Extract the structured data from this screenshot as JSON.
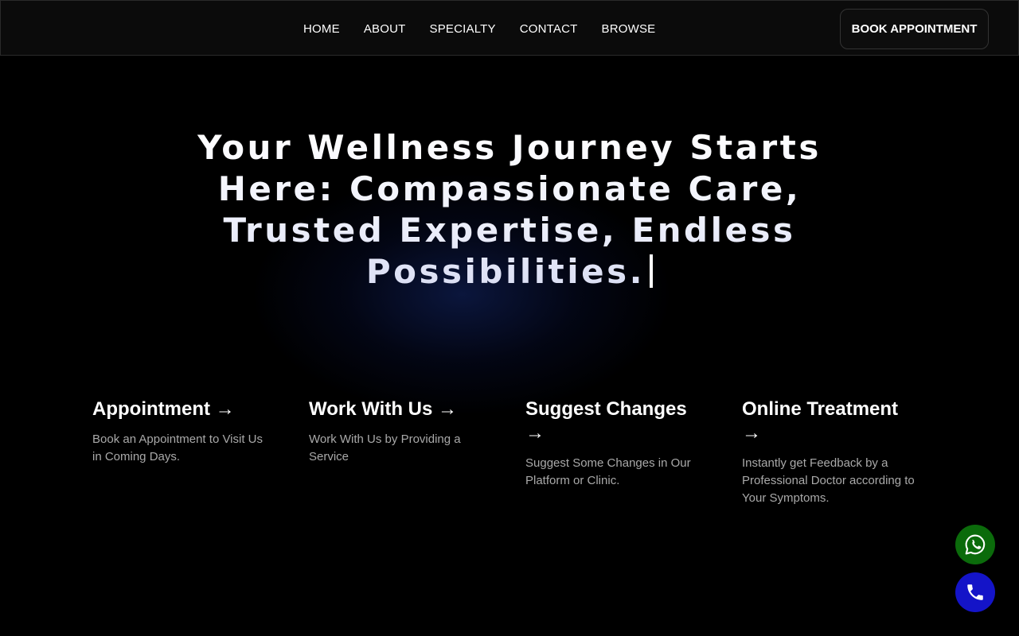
{
  "nav": {
    "links": [
      "HOME",
      "ABOUT",
      "SPECIALTY",
      "CONTACT",
      "BROWSE"
    ],
    "cta": "BOOK APPOINTMENT"
  },
  "hero": {
    "title": "Your Wellness Journey Starts Here: Compassionate Care, Trusted Expertise, Endless Possibilities."
  },
  "cards": [
    {
      "title": "Appointment →",
      "desc": "Book an Appointment to Visit Us in Coming Days."
    },
    {
      "title": "Work With Us →",
      "desc": "Work With Us by Providing a Service"
    },
    {
      "title": "Suggest Changes →",
      "desc": "Suggest Some Changes in Our Platform or Clinic."
    },
    {
      "title": "Online Treatment →",
      "desc": "Instantly get Feedback by a Professional Doctor according to Your Symptoms."
    }
  ],
  "floating": {
    "whatsapp_icon": "whatsapp-icon",
    "phone_icon": "phone-icon",
    "whatsapp_color": "#0b6b0b",
    "phone_color": "#1414c8"
  }
}
